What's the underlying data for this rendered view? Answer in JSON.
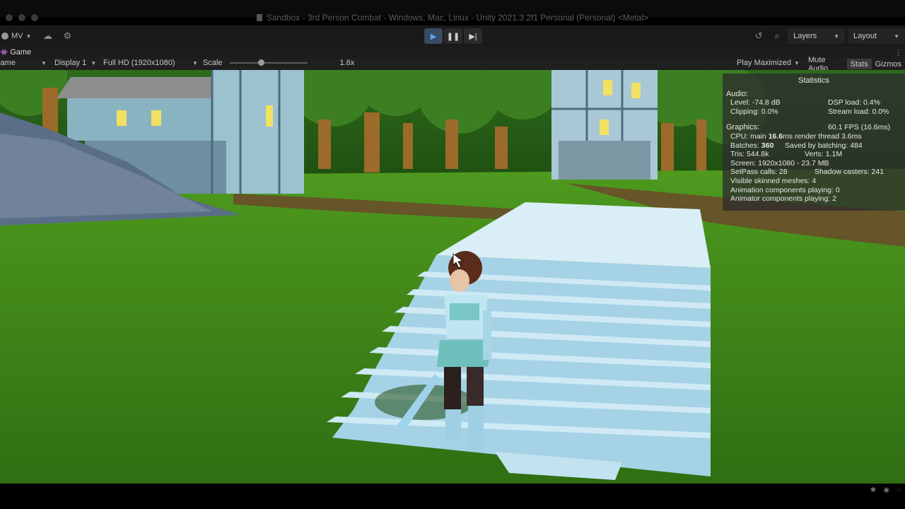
{
  "window": {
    "title": "Sandbox - 3rd Person Combat - Windows, Mac, Linux - Unity 2021.3.2f1 Personal (Personal) <Metal>"
  },
  "toolbar": {
    "account": "MV",
    "layers_label": "Layers",
    "layout_label": "Layout",
    "play_active": true
  },
  "tab": {
    "label": "Game"
  },
  "game_bar": {
    "view_mode": "Game",
    "display": "Display 1",
    "resolution": "Full HD (1920x1080)",
    "scale_label": "Scale",
    "scale_value": "1.6x",
    "play_mode": "Play Maximized",
    "mute_audio": "Mute Audio",
    "stats": "Stats",
    "gizmos": "Gizmos"
  },
  "statistics": {
    "title": "Statistics",
    "audio_header": "Audio:",
    "level": "Level: -74.8 dB",
    "dsp_load": "DSP load: 0.4%",
    "clipping": "Clipping: 0.0%",
    "stream_load": "Stream load: 0.0%",
    "graphics_header": "Graphics:",
    "fps": "60.1 FPS (16.6ms)",
    "cpu_prefix": "CPU: main ",
    "cpu_main": "16.6",
    "cpu_suffix": "ms  render thread 3.6ms",
    "batches_prefix": "Batches: ",
    "batches": "360",
    "saved_batching": "Saved by batching: 484",
    "tris": "Tris: 544.8k",
    "verts": "Verts: 1.1M",
    "screen": "Screen: 1920x1080 - 23.7 MB",
    "setpass": "SetPass calls: 28",
    "shadow_casters": "Shadow casters: 241",
    "skinned_meshes": "Visible skinned meshes: 4",
    "animation_components": "Animation components playing: 0",
    "animator_components": "Animator components playing: 2"
  },
  "colors": {
    "editor_bg": "#191919",
    "play_accent": "#5aa8ff",
    "grass": "#3f8a1c",
    "stairs": "#bfe3f2"
  }
}
